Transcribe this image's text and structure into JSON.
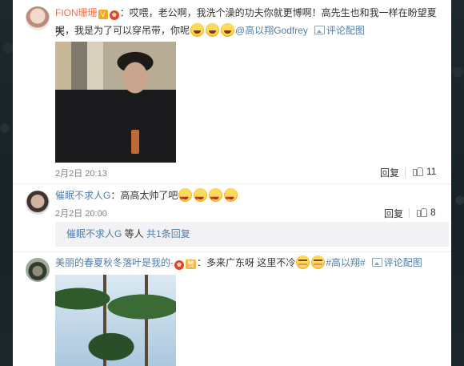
{
  "comments": [
    {
      "username": "FION珊珊",
      "badge_v": "V",
      "level_badge": "♚",
      "text_part1": "：哎喂，老公啊，我洗个澡的功夫你就更博啊！高先生也和我一样在盼望夏天",
      "text_part2": "呢，我是为了可以穿吊带，你呢",
      "emojis": [
        "laugh",
        "laugh",
        "laugh"
      ],
      "mention": "@高以翔Godfrey",
      "pic_link": "评论配图",
      "time": "2月2日 20:13",
      "reply_label": "回复",
      "like_count": "11"
    },
    {
      "username": "催眠不求人G",
      "text": "：高高太帅了吧",
      "emojis": [
        "heart",
        "heart",
        "heart",
        "heart"
      ],
      "time": "2月2日 20:00",
      "reply_label": "回复",
      "like_count": "8",
      "replies_summary": {
        "user": "催眠不求人G",
        "middle": " 等人 ",
        "link": "共1条回复"
      }
    },
    {
      "username": "美丽的春夏秋冬落叶是我的-",
      "level_badge": "♚",
      "badge_tag": "赞",
      "text": "：多来广东呀 这里不冷",
      "emojis": [
        "shy",
        "shy"
      ],
      "topic": "#高以翔#",
      "pic_link": "评论配图"
    }
  ],
  "colors": {
    "username": "#eb7350",
    "link": "#507daf",
    "meta": "#808080",
    "reply_box_bg": "#f2f2f5"
  }
}
